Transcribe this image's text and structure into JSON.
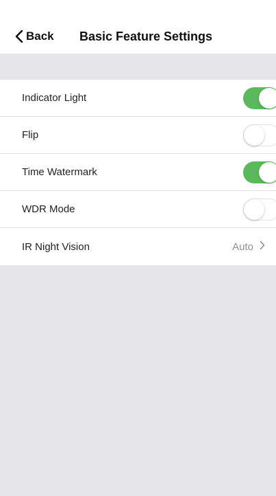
{
  "nav": {
    "back_label": "Back",
    "title": "Basic Feature Settings"
  },
  "settings": [
    {
      "label": "Indicator Light",
      "type": "toggle",
      "on": true
    },
    {
      "label": "Flip",
      "type": "toggle",
      "on": false
    },
    {
      "label": "Time Watermark",
      "type": "toggle",
      "on": true
    },
    {
      "label": "WDR Mode",
      "type": "toggle",
      "on": false
    },
    {
      "label": "IR Night Vision",
      "type": "value",
      "value": "Auto"
    }
  ],
  "colors": {
    "toggle_on": "#5cb85c",
    "background": "#e5e5ea"
  }
}
